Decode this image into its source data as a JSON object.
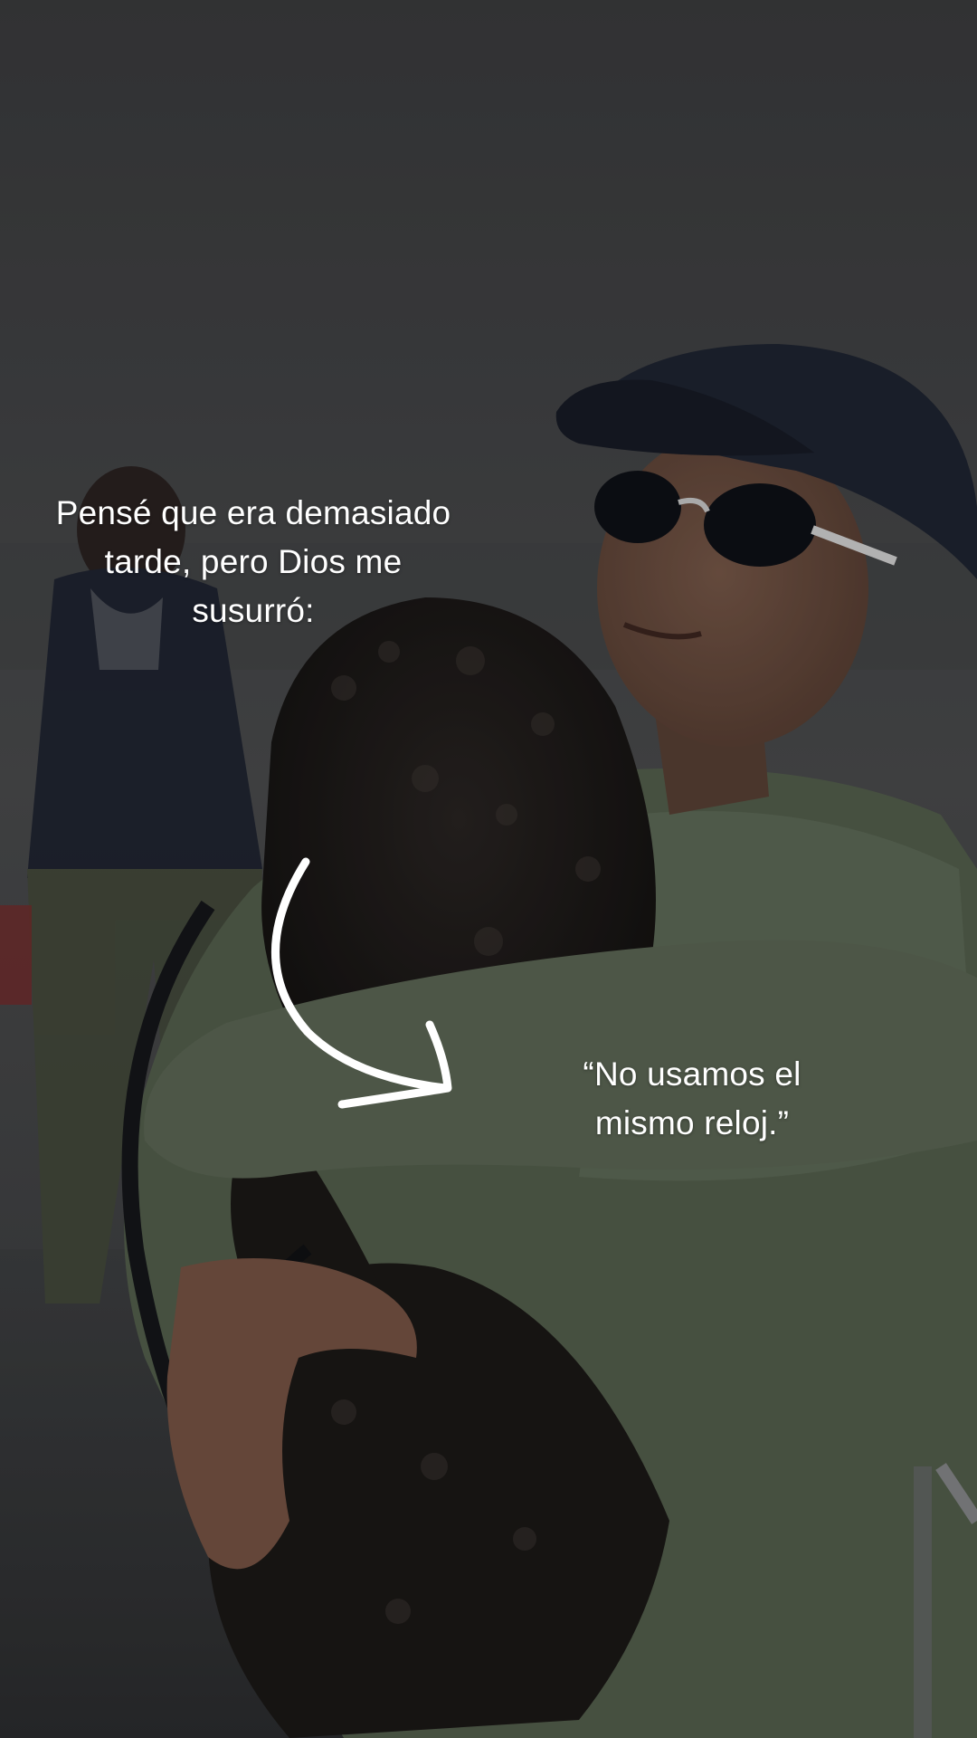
{
  "caption_top": {
    "lines": [
      "Pensé que era demasiado",
      "tarde, pero Dios me",
      "susurró:"
    ]
  },
  "caption_quote": {
    "lines": [
      "“No usamos el",
      "mismo reloj.”"
    ]
  },
  "icons": {
    "arrow": "curved-arrow-icon"
  },
  "colors": {
    "caption_text": "#ffffff",
    "sky": "#4a4b4d",
    "sweater": "#5b6a5a",
    "cap": "#1f2430",
    "dog": "#1a1716"
  }
}
